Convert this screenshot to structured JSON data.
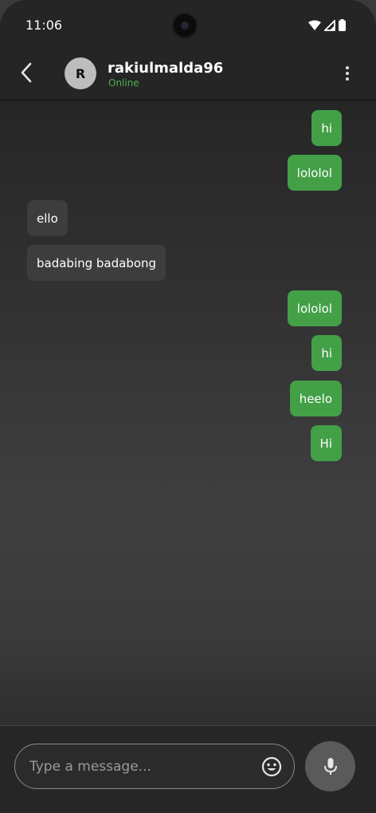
{
  "status_bar": {
    "time": "11:06",
    "icons": [
      "wifi-icon",
      "signal-icon",
      "battery-icon"
    ]
  },
  "header": {
    "avatar_initial": "R",
    "contact_name": "rakiulmalda96",
    "contact_status": "Online"
  },
  "messages": [
    {
      "text": "hi",
      "direction": "sent"
    },
    {
      "text": "lololol",
      "direction": "sent"
    },
    {
      "text": "ello",
      "direction": "received"
    },
    {
      "text": "badabing badabong",
      "direction": "received"
    },
    {
      "text": "lololol",
      "direction": "sent"
    },
    {
      "text": "hi",
      "direction": "sent"
    },
    {
      "text": "heelo",
      "direction": "sent"
    },
    {
      "text": "Hi",
      "direction": "sent"
    }
  ],
  "composer": {
    "placeholder": "Type a message...",
    "value": ""
  },
  "colors": {
    "sent_bubble": "#43a047",
    "received_bubble": "#3d3d3d",
    "online": "#4caf50",
    "background": "#2e2e2e"
  }
}
